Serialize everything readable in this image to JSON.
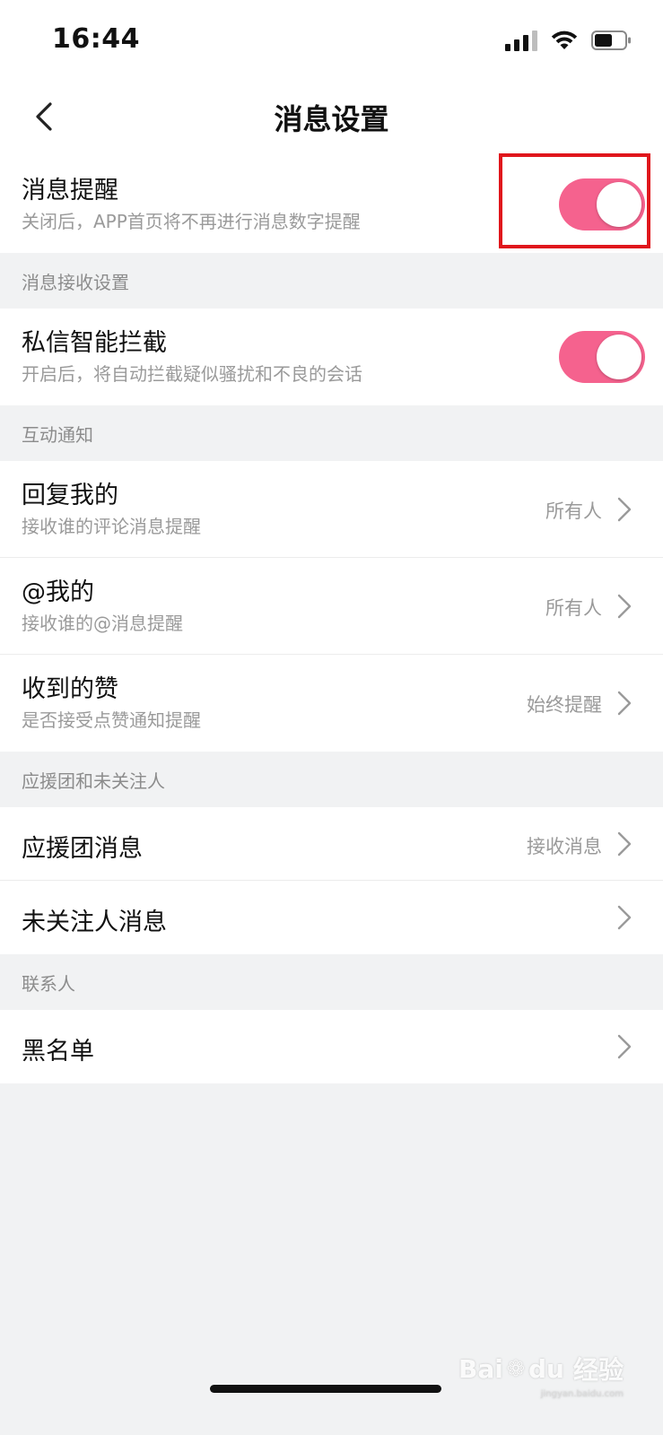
{
  "status_bar": {
    "time": "16:44"
  },
  "nav": {
    "title": "消息设置"
  },
  "message_reminder": {
    "title": "消息提醒",
    "subtitle": "关闭后，APP首页将不再进行消息数字提醒",
    "enabled": true
  },
  "sections": {
    "receive_settings": "消息接收设置",
    "interaction": "互动通知",
    "support_group": "应援团和未关注人",
    "contacts": "联系人"
  },
  "dm_filter": {
    "title": "私信智能拦截",
    "subtitle": "开启后，将自动拦截疑似骚扰和不良的会话",
    "enabled": true
  },
  "interaction_items": [
    {
      "title": "回复我的",
      "subtitle": "接收谁的评论消息提醒",
      "value": "所有人"
    },
    {
      "title": "@我的",
      "subtitle": "接收谁的@消息提醒",
      "value": "所有人"
    },
    {
      "title": "收到的赞",
      "subtitle": "是否接受点赞通知提醒",
      "value": "始终提醒"
    }
  ],
  "support_items": [
    {
      "title": "应援团消息",
      "value": "接收消息"
    },
    {
      "title": "未关注人消息",
      "value": ""
    }
  ],
  "contact_items": [
    {
      "title": "黑名单"
    }
  ],
  "watermark": {
    "brand": "Bai",
    "brand2": "du",
    "cn": "经验",
    "sub": "jingyan.baidu.com"
  },
  "colors": {
    "toggle_on": "#f5628e",
    "highlight": "#e0161c",
    "background": "#f1f2f3"
  }
}
